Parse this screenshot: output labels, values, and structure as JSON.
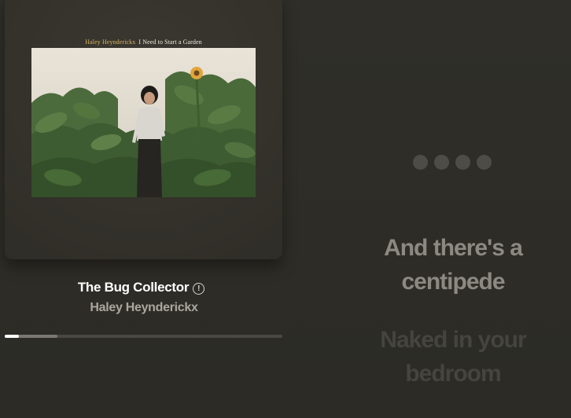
{
  "album": {
    "cover_artist_credit": "Haley Heynderickx",
    "cover_album_title": "I Need to Start a Garden"
  },
  "track": {
    "title": "The Bug Collector",
    "artist": "Haley Heynderickx",
    "explicit_icon_glyph": "!"
  },
  "progress": {
    "played_fraction": 0.05,
    "buffered_fraction": 0.19
  },
  "lyrics": {
    "current_line": "And there's a centipede",
    "next_line": "Naked in your bedroom"
  },
  "colors": {
    "background": "#2f2e28",
    "progress_fill": "#ffffff",
    "lyric_current": "#8b8982",
    "lyric_upcoming": "#45443e"
  },
  "icons": {
    "explicit": "info-circle-icon",
    "loading": "ellipsis-dots-icon"
  }
}
